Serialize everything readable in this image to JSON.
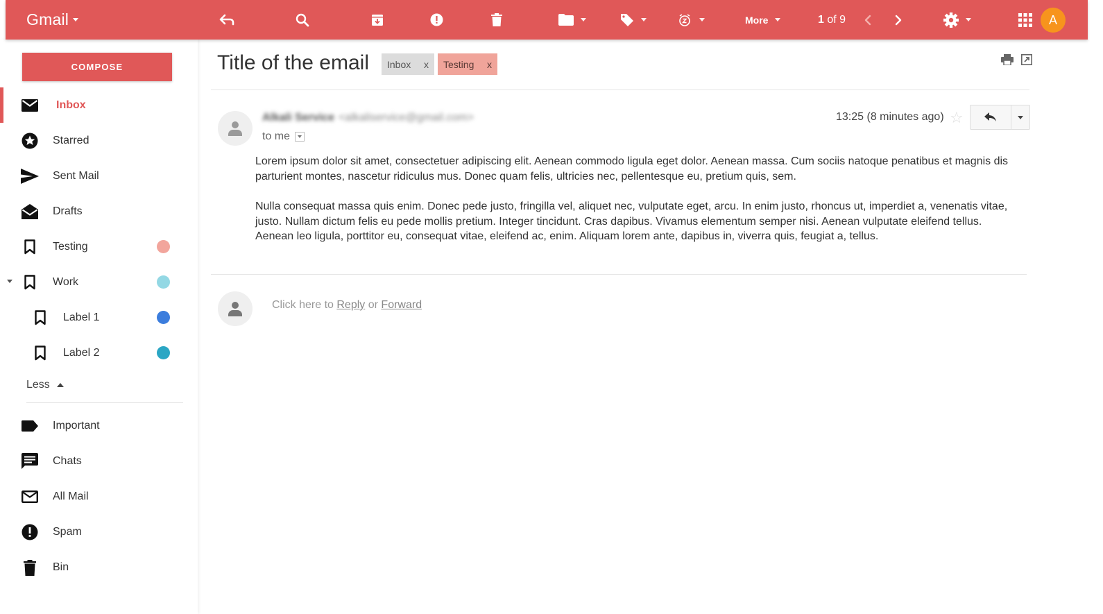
{
  "topbar": {
    "brand": "Gmail",
    "more_label": "More",
    "page_current": "1",
    "page_of": "of 9",
    "avatar_letter": "A",
    "accent": "#e05858",
    "avatar_color": "#f7941d"
  },
  "sidebar": {
    "compose_label": "COMPOSE",
    "items": [
      {
        "label": "Inbox",
        "icon": "inbox-icon"
      },
      {
        "label": "Starred",
        "icon": "star-icon"
      },
      {
        "label": "Sent Mail",
        "icon": "send-icon"
      },
      {
        "label": "Drafts",
        "icon": "drafts-icon"
      },
      {
        "label": "Testing",
        "icon": "label-icon",
        "color": "#f2a59c"
      },
      {
        "label": "Work",
        "icon": "label-icon",
        "color": "#93d8e4"
      },
      {
        "label": "Label 1",
        "icon": "label-icon",
        "color": "#3b7ddd"
      },
      {
        "label": "Label 2",
        "icon": "label-icon",
        "color": "#2aa6c4"
      },
      {
        "label": "Important",
        "icon": "important-icon"
      },
      {
        "label": "Chats",
        "icon": "chat-icon"
      },
      {
        "label": "All Mail",
        "icon": "mail-icon"
      },
      {
        "label": "Spam",
        "icon": "spam-icon"
      },
      {
        "label": "Bin",
        "icon": "trash-icon"
      }
    ],
    "less_label": "Less"
  },
  "email": {
    "title": "Title of the email",
    "labels": [
      {
        "name": "Inbox",
        "remove": "x"
      },
      {
        "name": "Testing",
        "remove": "x"
      }
    ],
    "sender_name": "Alkali Service",
    "sender_email": "<alkaliservice@gmail.com>",
    "to": "to me",
    "time": "13:25 (8 minutes ago)",
    "paragraphs": [
      "Lorem ipsum dolor sit amet, consectetuer adipiscing elit. Aenean commodo ligula eget dolor. Aenean massa. Cum sociis natoque penatibus et magnis dis parturient montes, nascetur ridiculus mus. Donec quam felis, ultricies nec, pellentesque eu, pretium quis, sem.",
      "Nulla consequat massa quis enim. Donec pede justo, fringilla vel, aliquet nec, vulputate eget, arcu. In enim justo, rhoncus ut, imperdiet a, venenatis vitae, justo. Nullam dictum felis eu pede mollis pretium. Integer tincidunt. Cras dapibus. Vivamus elementum semper nisi. Aenean vulputate eleifend tellus. Aenean leo ligula, porttitor eu, consequat vitae, eleifend ac, enim. Aliquam lorem ante, dapibus in, viverra quis, feugiat a, tellus."
    ]
  },
  "reply": {
    "prefix": "Click here to",
    "reply_link": "Reply",
    "or": "or",
    "forward_link": "Forward"
  }
}
